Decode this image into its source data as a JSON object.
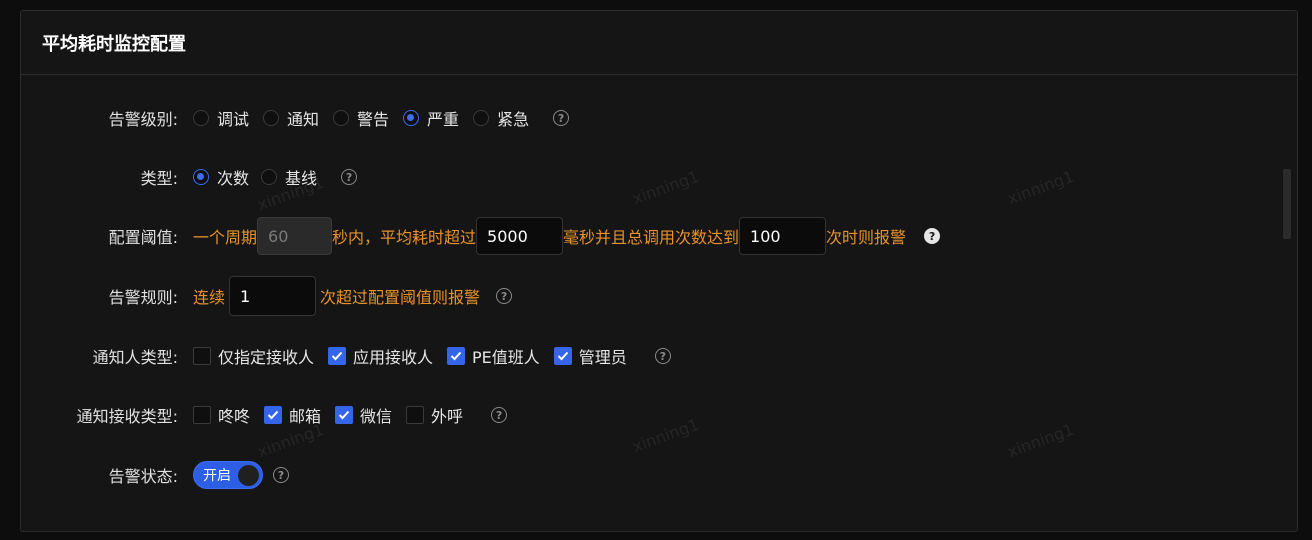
{
  "panel": {
    "title": "平均耗时监控配置"
  },
  "alert_level": {
    "label": "告警级别:",
    "options": [
      "调试",
      "通知",
      "警告",
      "严重",
      "紧急"
    ],
    "selected": "严重"
  },
  "type": {
    "label": "类型:",
    "options": [
      "次数",
      "基线"
    ],
    "selected": "次数"
  },
  "threshold": {
    "label": "配置阈值:",
    "text1": "一个周期",
    "period_value": "60",
    "text2": "秒内，平均耗时超过",
    "latency_value": "5000",
    "text3": "毫秒并且总调用次数达到",
    "count_value": "100",
    "text4": "次时则报警"
  },
  "rule": {
    "label": "告警规则:",
    "text1": "连续",
    "value": "1",
    "text2": "次超过配置阈值则报警"
  },
  "notify_people": {
    "label": "通知人类型:",
    "options": [
      {
        "label": "仅指定接收人",
        "checked": false
      },
      {
        "label": "应用接收人",
        "checked": true
      },
      {
        "label": "PE值班人",
        "checked": true
      },
      {
        "label": "管理员",
        "checked": true
      }
    ]
  },
  "notify_channel": {
    "label": "通知接收类型:",
    "options": [
      {
        "label": "咚咚",
        "checked": false
      },
      {
        "label": "邮箱",
        "checked": true
      },
      {
        "label": "微信",
        "checked": true
      },
      {
        "label": "外呼",
        "checked": false
      }
    ]
  },
  "status": {
    "label": "告警状态:",
    "toggle_label": "开启",
    "on": true
  },
  "help_glyph": "?",
  "watermark": "xinning1",
  "colors": {
    "accent": "#3565e8",
    "orange": "#e7922a",
    "background": "#151515"
  }
}
